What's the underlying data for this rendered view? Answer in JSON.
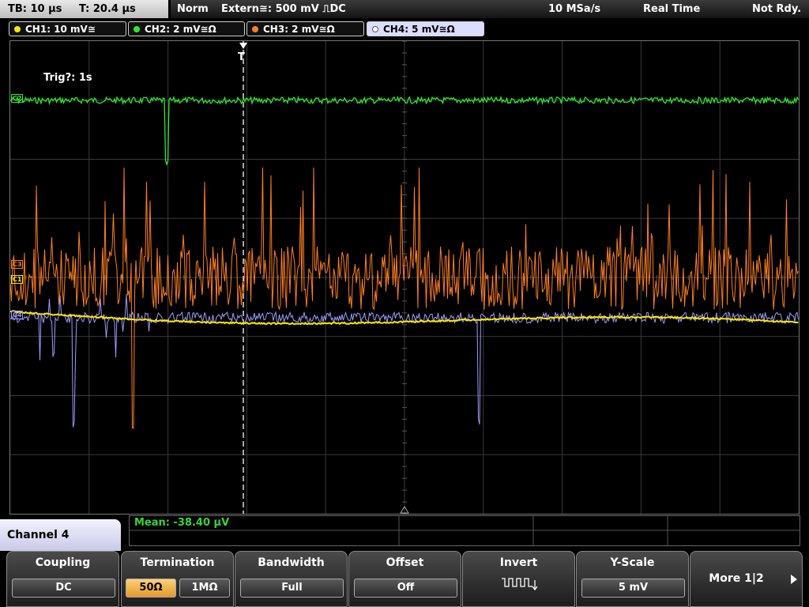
{
  "topbar": {
    "timebase": "TB: 10 µs",
    "trigger_time": "T: 20.4 µs",
    "mode": "Norm",
    "trigger_source": "Extern≅: 500 mV ⎍DC",
    "sample_rate": "10 MSa/s",
    "acq_mode": "Real Time",
    "status": "Not Rdy."
  },
  "channels": [
    {
      "label": "CH1: 10 mV≅",
      "color": "#ffe600"
    },
    {
      "label": "CH2: 2 mV≅Ω",
      "color": "#2ee82e"
    },
    {
      "label": "CH3: 2 mV≅Ω",
      "color": "#ff7f1e"
    },
    {
      "label": "CH4: 5 mV≅Ω",
      "color": "#9b9bff"
    }
  ],
  "scope": {
    "trig_label": "Trig?: 1s",
    "trigger_marker": "T",
    "ch2_marker": "C2",
    "ch3_marker": "C3",
    "ch4_marker": "C4",
    "ch1_marker": "C1"
  },
  "measurement": {
    "mean": "Mean: -38.40 µV"
  },
  "menu": {
    "title": "Channel 4",
    "softkeys": [
      {
        "title": "Coupling",
        "value": "DC"
      },
      {
        "title": "Termination",
        "options": [
          "50Ω",
          "1MΩ"
        ],
        "selected": "50Ω"
      },
      {
        "title": "Bandwidth",
        "value": "Full"
      },
      {
        "title": "Offset",
        "value": "Off"
      },
      {
        "title": "Invert",
        "value": ""
      },
      {
        "title": "Y-Scale",
        "value": "5 mV"
      },
      {
        "title": "More 1|2",
        "value": ""
      }
    ]
  }
}
